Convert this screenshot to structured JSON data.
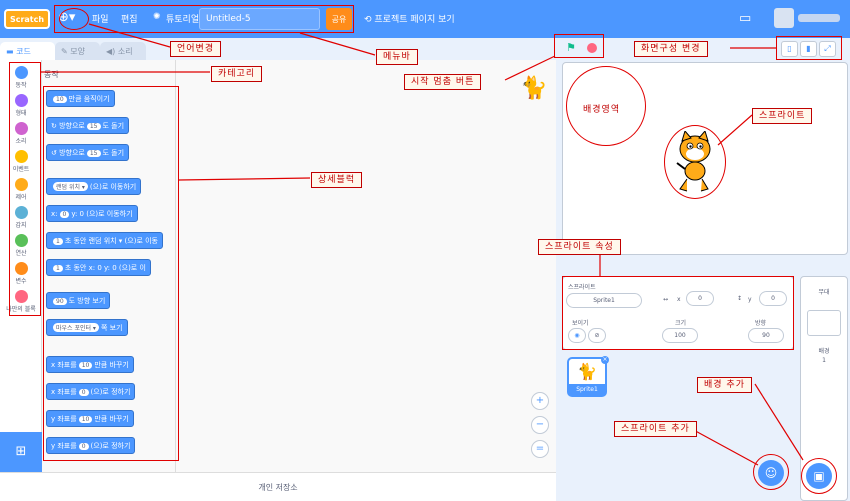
{
  "menubar": {
    "logo": "Scratch",
    "file": "파일",
    "edit": "편집",
    "tutorials": "튜토리얼",
    "title": "Untitled-5",
    "share": "공유",
    "project_page": "프로젝트 페이지 보기"
  },
  "tabs": {
    "code": "코드",
    "costume": "모양",
    "sound": "소리"
  },
  "categories": [
    {
      "label": "동작",
      "color": "#4c97ff"
    },
    {
      "label": "형태",
      "color": "#9966ff"
    },
    {
      "label": "소리",
      "color": "#cf63cf"
    },
    {
      "label": "이벤트",
      "color": "#ffbf00"
    },
    {
      "label": "제어",
      "color": "#ffab19"
    },
    {
      "label": "감지",
      "color": "#5cb1d6"
    },
    {
      "label": "연산",
      "color": "#59c059"
    },
    {
      "label": "변수",
      "color": "#ff8c1a"
    },
    {
      "label": "나만의 블록",
      "color": "#ff6680"
    }
  ],
  "palette": {
    "title": "동작",
    "blocks": [
      {
        "pre": "",
        "pill": "10",
        "post": "만큼 움직이기"
      },
      {
        "pre": "↻ 방향으로",
        "pill": "15",
        "post": "도 돌기"
      },
      {
        "pre": "↺ 방향으로",
        "pill": "15",
        "post": "도 돌기"
      },
      {
        "pre": "",
        "pill": "랜덤 위치 ▾",
        "post": "(으)로 이동하기"
      },
      {
        "pre": "x:",
        "pill": "0",
        "post": "y: 0 (으)로 이동하기"
      },
      {
        "pre": "",
        "pill": "1",
        "post": "초 동안 랜덤 위치 ▾ (으)로 이동"
      },
      {
        "pre": "",
        "pill": "1",
        "post": "초 동안 x: 0 y: 0 (으)로 이"
      },
      {
        "pre": "",
        "pill": "90",
        "post": "도 방향 보기"
      },
      {
        "pre": "",
        "pill": "마우스 포인터 ▾",
        "post": "쪽 보기"
      },
      {
        "pre": "x 좌표를",
        "pill": "10",
        "post": "만큼 바꾸기"
      },
      {
        "pre": "x 좌표를",
        "pill": "0",
        "post": "(으)로 정하기"
      },
      {
        "pre": "y 좌표를",
        "pill": "10",
        "post": "만큼 바꾸기"
      },
      {
        "pre": "y 좌표를",
        "pill": "0",
        "post": "(으)로 정하기"
      }
    ]
  },
  "backpack": "개인 저장소",
  "sprite_info": {
    "sprite_label": "스프라이트",
    "sprite_name": "Sprite1",
    "x_label": "x",
    "x_value": "0",
    "y_label": "y",
    "y_value": "0",
    "show_label": "보이기",
    "size_label": "크기",
    "size_value": "100",
    "direction_label": "방향",
    "direction_value": "90"
  },
  "sprite_thumb": "Sprite1",
  "stage_panel": {
    "title": "무대",
    "backdrop_label": "배경",
    "backdrop_count": "1"
  },
  "annotations": {
    "language": "언어변경",
    "menubar": "메뉴바",
    "category": "카테고리",
    "start_stop": "시작 멈춤 버튼",
    "layout": "화면구성 변경",
    "stage_area": "배경영역",
    "sprite": "스프라이트",
    "blocks": "상세블럭",
    "sprite_props": "스프라이트 속성",
    "add_backdrop": "배경 추가",
    "add_sprite": "스프라이트 추가"
  }
}
